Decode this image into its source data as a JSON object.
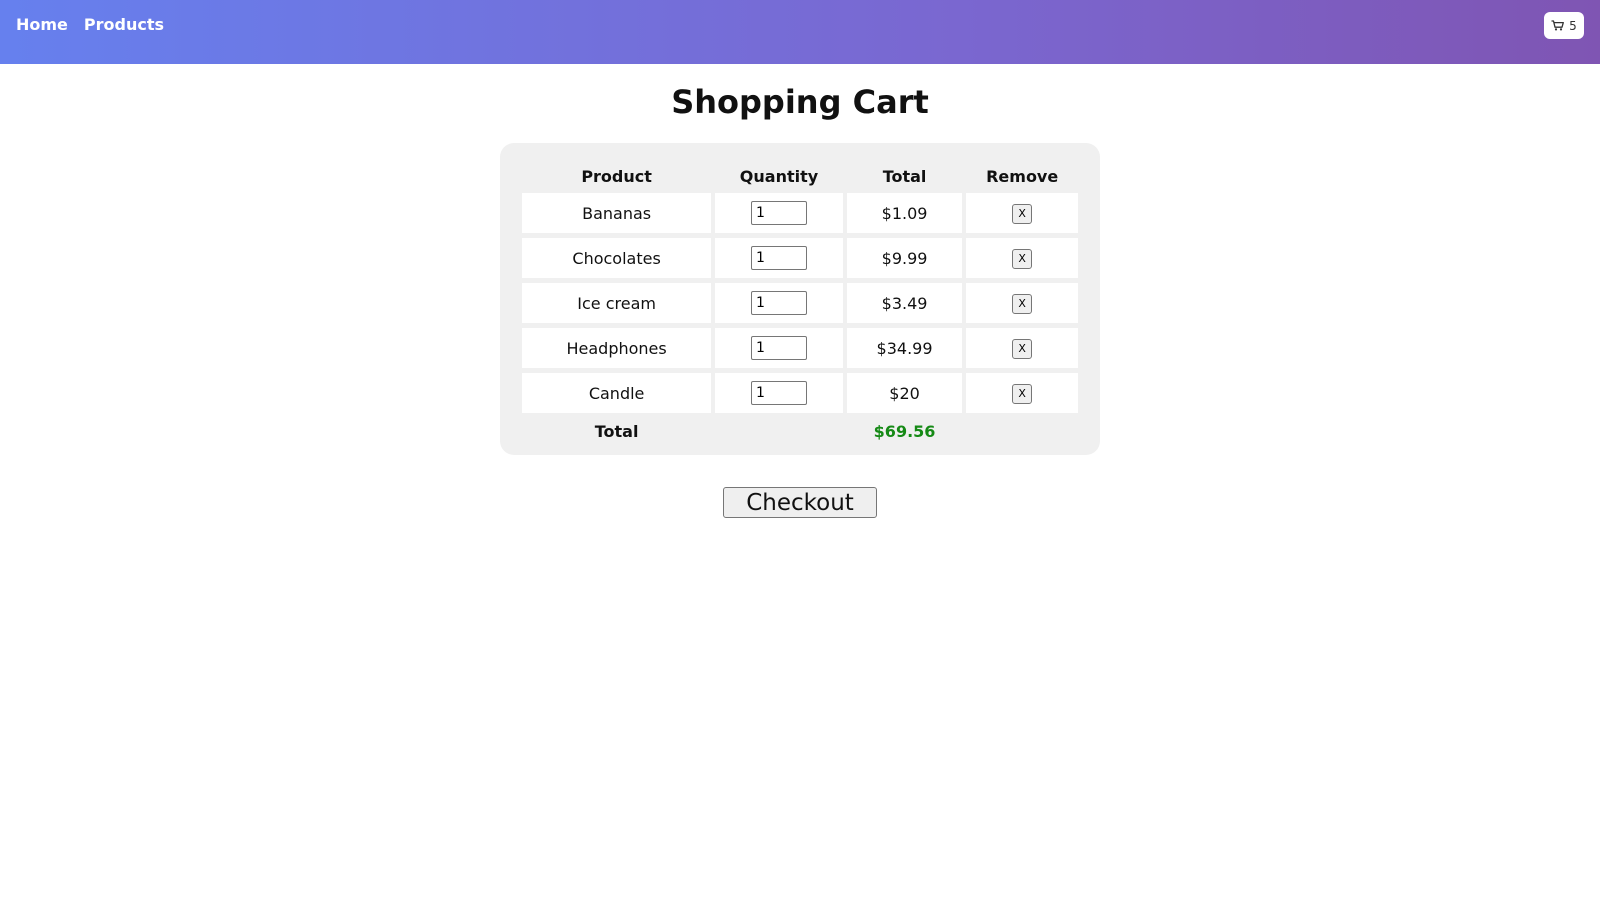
{
  "nav": {
    "home": "Home",
    "products": "Products"
  },
  "cart_badge": {
    "icon": "shopping-cart-icon",
    "count": "5"
  },
  "page_title": "Shopping Cart",
  "table": {
    "headers": {
      "product": "Product",
      "quantity": "Quantity",
      "total": "Total",
      "remove": "Remove"
    },
    "rows": [
      {
        "product": "Bananas",
        "quantity": "1",
        "total": "$1.09",
        "remove": "X"
      },
      {
        "product": "Chocolates",
        "quantity": "1",
        "total": "$9.99",
        "remove": "X"
      },
      {
        "product": "Ice cream",
        "quantity": "1",
        "total": "$3.49",
        "remove": "X"
      },
      {
        "product": "Headphones",
        "quantity": "1",
        "total": "$34.99",
        "remove": "X"
      },
      {
        "product": "Candle",
        "quantity": "1",
        "total": "$20",
        "remove": "X"
      }
    ],
    "footer": {
      "label": "Total",
      "amount": "$69.56"
    }
  },
  "checkout_label": "Checkout",
  "colors": {
    "header_gradient_start": "#6680ee",
    "header_gradient_end": "#7f55b3",
    "total_amount": "#168a16",
    "panel_background": "#f0f0f0"
  }
}
